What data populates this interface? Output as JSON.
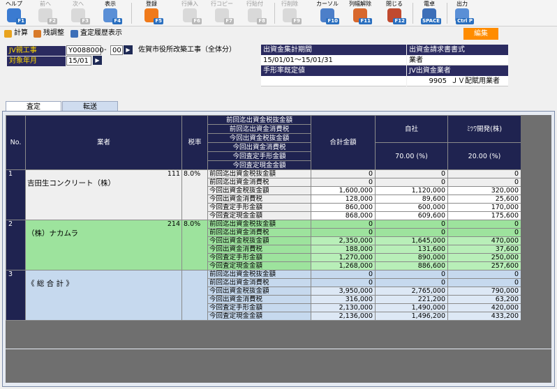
{
  "toolbar": {
    "buttons": [
      {
        "label": "ヘルプ",
        "key": "F1",
        "icon": "help-icon",
        "color": "#3b7bd1"
      },
      {
        "label": "前へ",
        "key": "F2",
        "icon": "arrow-left-icon",
        "color": "#cfcfcf"
      },
      {
        "label": "次へ",
        "key": "F3",
        "icon": "arrow-right-icon",
        "color": "#cfcfcf"
      },
      {
        "label": "表示",
        "key": "F4",
        "icon": "magnifier-icon",
        "color": "#5a8fd6"
      },
      {
        "label": "登録",
        "key": "F5",
        "icon": "ok-icon",
        "color": "#f07a1a"
      },
      {
        "label": "行挿入",
        "key": "F6",
        "icon": "row-insert-icon",
        "color": "#cfcfcf"
      },
      {
        "label": "行コピー",
        "key": "F7",
        "icon": "row-copy-icon",
        "color": "#cfcfcf"
      },
      {
        "label": "行貼付",
        "key": "F8",
        "icon": "row-paste-icon",
        "color": "#cfcfcf"
      },
      {
        "label": "行削除",
        "key": "F9",
        "icon": "row-delete-icon",
        "color": "#cfcfcf"
      },
      {
        "label": "カーソル",
        "key": "F10",
        "icon": "cursor-icon",
        "color": "#4c7fc9"
      },
      {
        "label": "列幅解除",
        "key": "F11",
        "icon": "column-width-icon",
        "color": "#d8682d"
      },
      {
        "label": "閉じる",
        "key": "F12",
        "icon": "close-icon",
        "color": "#c04a2f"
      },
      {
        "label": "電卓",
        "key": "SPACE",
        "icon": "calculator-icon",
        "color": "#3d6fb8"
      },
      {
        "label": "出力",
        "key": "Ctrl P",
        "icon": "printer-icon",
        "color": "#5a8fd6"
      }
    ]
  },
  "actions": {
    "calc": "計算",
    "adjust": "残調整",
    "history": "査定履歴表示",
    "edit": "編集"
  },
  "form": {
    "jv_label": "JV親工事",
    "jv_code": "Y0088000",
    "jv_dash": "-",
    "jv_branch": "00",
    "jv_name": "佐賀市役所改築工事（全体分）",
    "month_label": "対象年月",
    "month_value": "15/01"
  },
  "info": {
    "period_label": "出資金集計期間",
    "period_value": "15/01/01〜15/01/31",
    "invoice_label": "出資金請求書書式",
    "invoice_value": "業者",
    "note_label": "手形率既定値",
    "jv_vendor_label": "JV出資金業者",
    "jv_vendor_code": "9905",
    "jv_vendor_name": "ＪＶ配賦用業者"
  },
  "tabs": [
    "査定",
    "転送"
  ],
  "grid": {
    "headers": {
      "no": "No.",
      "vendor": "業者",
      "tax": "税率",
      "items": [
        "前回迄出資金税抜金額",
        "前回迄出資金消費税",
        "今回出資金税抜金額",
        "今回出資金消費税",
        "今回査定手形金額",
        "今回査定現金金額"
      ],
      "total": "合計金額",
      "company1": "自社",
      "company1_pct": "70.00 (%)",
      "company2": "ﾐﾂﾜ開発(株)",
      "company2_pct": "20.00 (%)"
    },
    "groups": [
      {
        "no": "1",
        "code": "111",
        "name": "吉田生コンクリート（株）",
        "tax": "8.0%",
        "rows": [
          {
            "item": "前回迄出資金税抜金額",
            "total": "0",
            "c1": "0",
            "c2": "0"
          },
          {
            "item": "前回迄出資金消費税",
            "total": "0",
            "c1": "0",
            "c2": "0"
          },
          {
            "item": "今回出資金税抜金額",
            "total": "1,600,000",
            "c1": "1,120,000",
            "c2": "320,000"
          },
          {
            "item": "今回出資金消費税",
            "total": "128,000",
            "c1": "89,600",
            "c2": "25,600"
          },
          {
            "item": "今回査定手形金額",
            "total": "860,000",
            "c1": "600,000",
            "c2": "170,000"
          },
          {
            "item": "今回査定現金金額",
            "total": "868,000",
            "c1": "609,600",
            "c2": "175,600"
          }
        ]
      },
      {
        "no": "2",
        "code": "214",
        "name": "（株）ナカムラ",
        "tax": "8.0%",
        "rows": [
          {
            "item": "前回迄出資金税抜金額",
            "total": "0",
            "c1": "0",
            "c2": "0"
          },
          {
            "item": "前回迄出資金消費税",
            "total": "0",
            "c1": "0",
            "c2": "0"
          },
          {
            "item": "今回出資金税抜金額",
            "total": "2,350,000",
            "c1": "1,645,000",
            "c2": "470,000"
          },
          {
            "item": "今回出資金消費税",
            "total": "188,000",
            "c1": "131,600",
            "c2": "37,600"
          },
          {
            "item": "今回査定手形金額",
            "total": "1,270,000",
            "c1": "890,000",
            "c2": "250,000"
          },
          {
            "item": "今回査定現金金額",
            "total": "1,268,000",
            "c1": "886,600",
            "c2": "257,600"
          }
        ]
      },
      {
        "no": "3",
        "code": "",
        "name": "《 総 合 計 》",
        "tax": "",
        "rows": [
          {
            "item": "前回迄出資金税抜金額",
            "total": "0",
            "c1": "0",
            "c2": "0"
          },
          {
            "item": "前回迄出資金消費税",
            "total": "0",
            "c1": "0",
            "c2": "0"
          },
          {
            "item": "今回出資金税抜金額",
            "total": "3,950,000",
            "c1": "2,765,000",
            "c2": "790,000"
          },
          {
            "item": "今回出資金消費税",
            "total": "316,000",
            "c1": "221,200",
            "c2": "63,200"
          },
          {
            "item": "今回査定手形金額",
            "total": "2,130,000",
            "c1": "1,490,000",
            "c2": "420,000"
          },
          {
            "item": "今回査定現金金額",
            "total": "2,136,000",
            "c1": "1,496,200",
            "c2": "433,200"
          }
        ]
      }
    ]
  }
}
